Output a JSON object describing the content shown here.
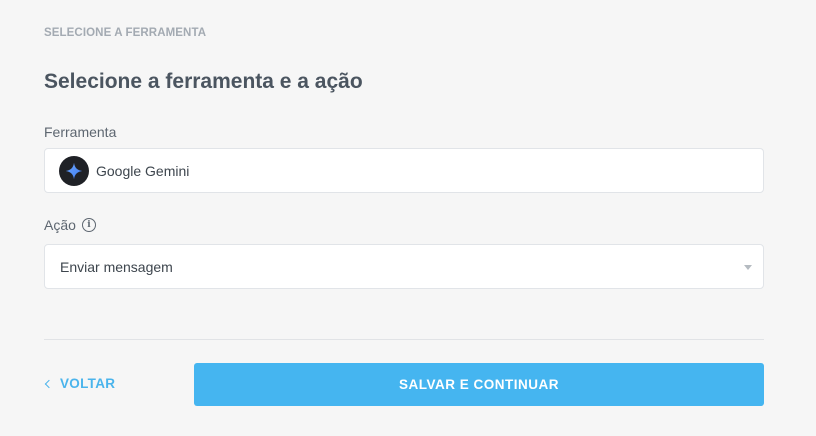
{
  "step_label": "SELECIONE A FERRAMENTA",
  "title": "Selecione a ferramenta e a ação",
  "tool_field": {
    "label": "Ferramenta",
    "value": "Google Gemini",
    "icon": "gemini-logo-icon"
  },
  "action_field": {
    "label": "Ação",
    "info_icon": "info-icon",
    "value": "Enviar mensagem",
    "caret_icon": "caret-down-icon"
  },
  "footer": {
    "back_label": "VOLTAR",
    "back_icon": "chevron-left-icon",
    "primary_label": "SALVAR E CONTINUAR"
  },
  "colors": {
    "accent": "#45b5f0",
    "link": "#4ab4ec",
    "background": "#f6f6f6",
    "title_text": "#4b5560"
  }
}
